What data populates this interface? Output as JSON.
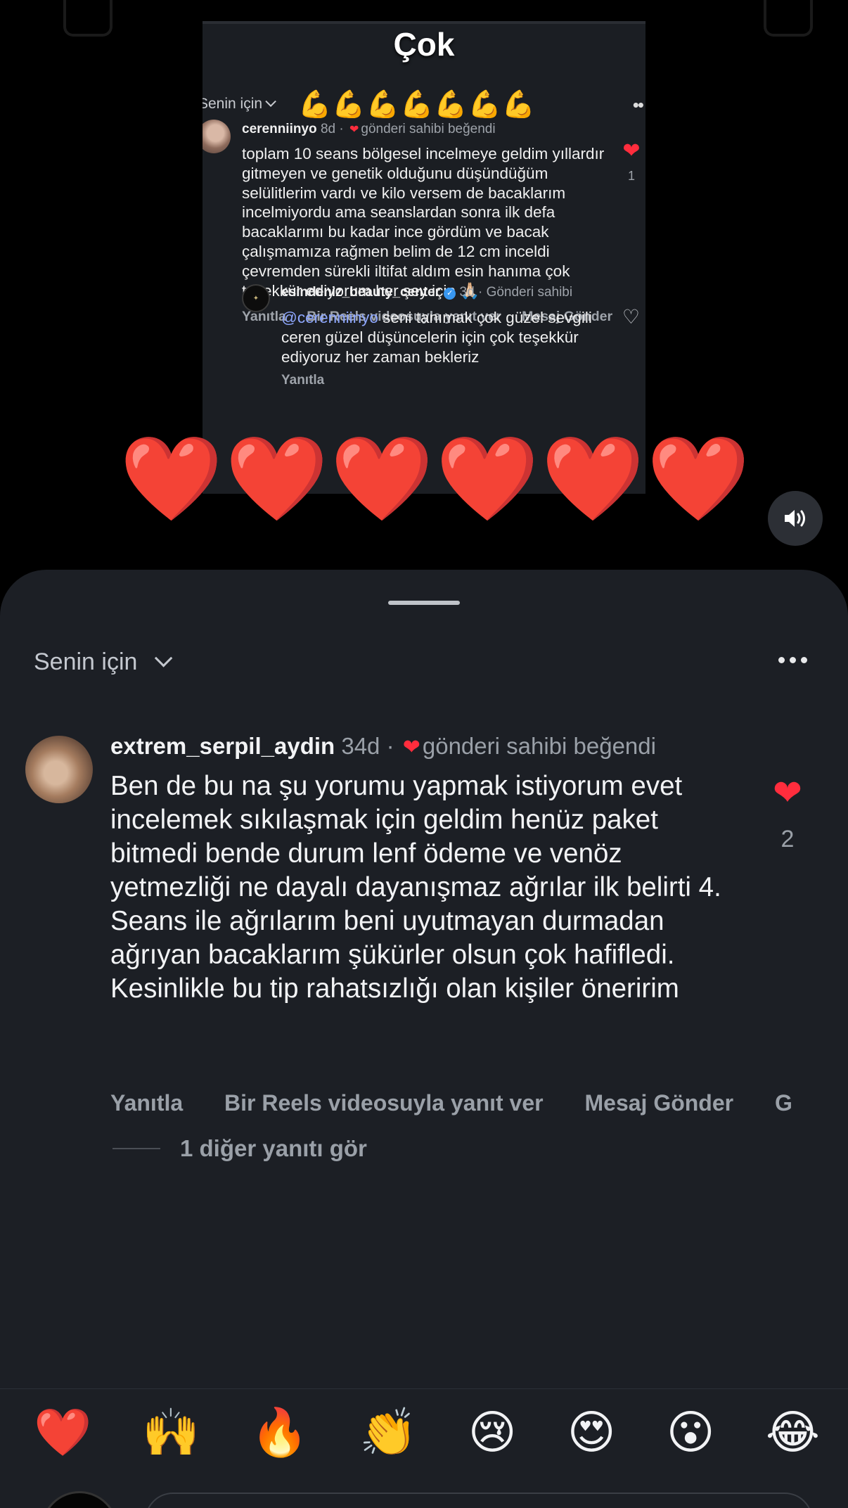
{
  "video": {
    "overlay_title": "Çok",
    "flex_emojis": "💪💪💪💪💪💪💪",
    "hearts": [
      "❤️",
      "❤️",
      "❤️",
      "❤️",
      "❤️",
      "❤️"
    ],
    "inner": {
      "filter_label": "Senin için",
      "comment": {
        "username": "cerenniinyo",
        "age": "8d",
        "liked_text": "gönderi sahibi beğendi",
        "text": "toplam 10 seans bölgesel incelmeye geldim yıllardır gitmeyen ve genetik olduğunu düşündüğüm selülitlerim vardı ve kilo versem de bacaklarım incelmiyordu ama seanslardan sonra ilk defa bacaklarımı bu kadar ince gördüm ve bacak çalışmamıza rağmen belim de 12 cm inceldi çevremden sürekli iltifat aldım esin hanıma çok teşekkür ediyorum her şey için 🙏🏻",
        "like_count": "1",
        "actions": [
          "Yanıtla",
          "Bir Reels videosuyla yanıt ver",
          "Mesaj Gönder"
        ]
      },
      "reply": {
        "username": "esindeniz_beauty_center",
        "meta": "3d · Gönderi sahibi",
        "mention": "@cerenniinyo",
        "text": " seni tanımak çok güzel sevgili ceren güzel düşüncelerin için çok teşekkür ediyoruz her zaman bekleriz",
        "actions_partial": "Yanıtla"
      }
    }
  },
  "sheet": {
    "filter_label": "Senin için",
    "comment": {
      "username": "extrem_serpil_aydin",
      "age": "34d",
      "liked_text": "gönderi sahibi beğendi",
      "text": "Ben de bu na şu yorumu yapmak istiyorum evet incelemek sıkılaşmak için geldim henüz paket bitmedi bende durum lenf ödeme ve venöz yetmezliği ne dayalı dayanışmaz ağrılar ilk belirti 4. Seans ile ağrılarım beni uyutmayan durmadan ağrıyan bacaklarım şükürler olsun çok hafifledi. Kesinlikle bu tip rahatsızlığı olan kişiler  öneririm",
      "like_count": "2",
      "actions": [
        "Yanıtla",
        "Bir Reels videosuyla yanıt ver",
        "Mesaj Gönder",
        "G"
      ],
      "view_replies": "1 diğer yanıtı gör"
    },
    "emoji_reactions": [
      "❤️",
      "🙌",
      "🔥",
      "👏",
      "😢",
      "😍",
      "😮",
      "😂"
    ]
  },
  "colors": {
    "sheet_bg": "#1c1f25",
    "like_red": "#ff2d3d",
    "muted_text": "#9aa0a8",
    "mention_blue": "#8fa8ff",
    "verified_blue": "#3897f0"
  }
}
